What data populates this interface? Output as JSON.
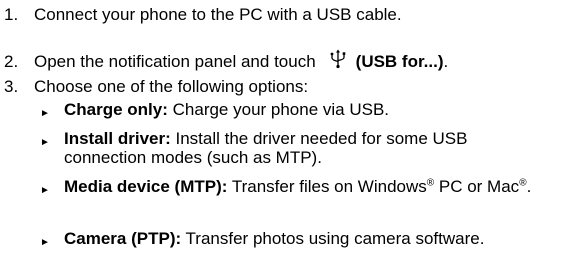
{
  "steps": [
    {
      "num": "1.",
      "text": "Connect your phone to the PC with a USB cable."
    },
    {
      "num": "2.",
      "text": "Open the notification panel and touch",
      "bold": "(USB for...)",
      "tail": "."
    },
    {
      "num": "3.",
      "text": "Choose one of the following options:"
    }
  ],
  "icons": {
    "usb": "usb-icon",
    "bullet": "triangle-bullet-icon"
  },
  "bullet_glyph": "►",
  "options": [
    {
      "label": "Charge only:",
      "desc": " Charge your phone via USB."
    },
    {
      "label": "Install driver:",
      "desc": " Install the driver needed for some USB connection modes (such as MTP)."
    },
    {
      "label": "Media device (MTP):",
      "desc_a": " Transfer files on Windows",
      "sup_a": "®",
      "desc_b": " PC or Mac",
      "sup_b": "®",
      "desc_c": "."
    },
    {
      "label": "Camera (PTP):",
      "desc": " Transfer photos using camera software."
    }
  ]
}
